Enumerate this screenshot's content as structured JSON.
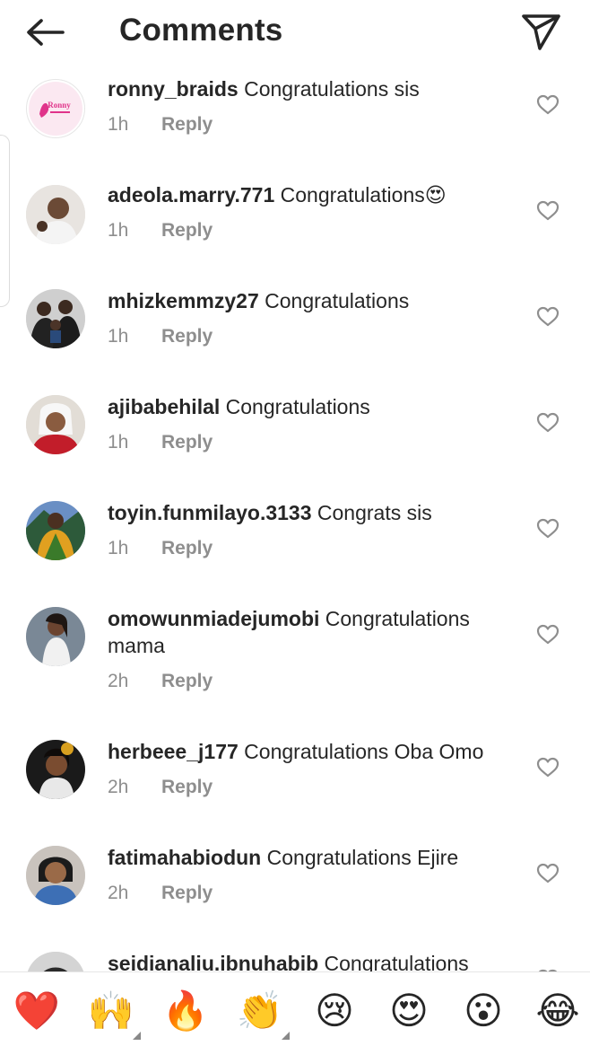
{
  "header": {
    "title": "Comments",
    "back_icon": "arrow-left-icon",
    "send_icon": "paper-plane-icon"
  },
  "reply_label": "Reply",
  "comments": [
    {
      "username": "ronny_braids",
      "text": "Congratulations sis",
      "time": "1h",
      "avatar_logo_text": "Ronny"
    },
    {
      "username": "adeola.marry.771",
      "text": "Congratulations😍",
      "time": "1h"
    },
    {
      "username": "mhizkemmzy27",
      "text": "Congratulations",
      "time": "1h"
    },
    {
      "username": "ajibabehilal",
      "text": "Congratulations",
      "time": "1h"
    },
    {
      "username": "toyin.funmilayo.3133",
      "text": "Congrats sis",
      "time": "1h"
    },
    {
      "username": "omowunmiadejumobi",
      "text": "Congratulations mama",
      "time": "2h"
    },
    {
      "username": "herbeee_j177",
      "text": "Congratulations Oba Omo",
      "time": "2h"
    },
    {
      "username": "fatimahabiodun",
      "text": "Congratulations Ejire",
      "time": "2h"
    },
    {
      "username": "seidianaliu.ibnuhabib",
      "text": "Congratulations",
      "time": ""
    }
  ],
  "emoji_bar": [
    {
      "name": "red-heart-emoji",
      "glyph": "❤️"
    },
    {
      "name": "raising-hands-emoji",
      "glyph": "🙌"
    },
    {
      "name": "fire-emoji",
      "glyph": "🔥"
    },
    {
      "name": "clapping-hands-emoji",
      "glyph": "👏"
    },
    {
      "name": "crying-face-emoji",
      "glyph": "😢"
    },
    {
      "name": "heart-eyes-emoji",
      "glyph": "😍"
    },
    {
      "name": "surprised-face-emoji",
      "glyph": "😮"
    },
    {
      "name": "tears-of-joy-emoji",
      "glyph": "😂"
    }
  ],
  "colors": {
    "text": "#262626",
    "secondary": "#8e8e8e",
    "background": "#ffffff",
    "logo_pink": "#e0338a"
  }
}
